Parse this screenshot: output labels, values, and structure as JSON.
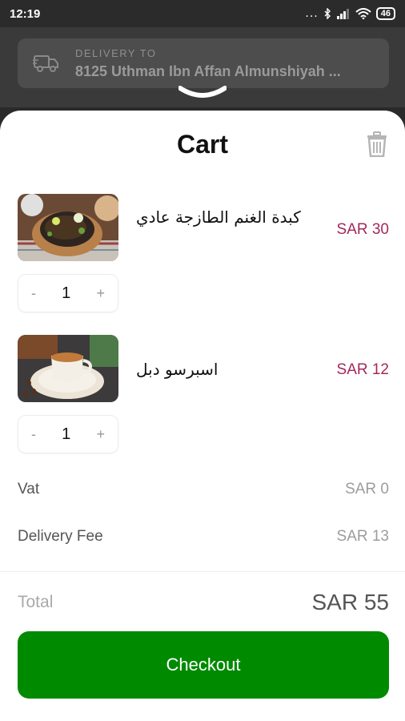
{
  "status_bar": {
    "time": "12:19",
    "dots": "...",
    "battery": "46"
  },
  "header": {
    "delivery_label": "DELIVERY TO",
    "delivery_address": "8125 Uthman Ibn Affan Almunshiyah ..."
  },
  "cart": {
    "title": "Cart",
    "items": [
      {
        "name": "كبدة الغنم الطازجة عادي",
        "price": "SAR 30",
        "quantity": "1",
        "minus": "-",
        "plus": "+"
      },
      {
        "name": "اسبرسو دبل",
        "price": "SAR 12",
        "quantity": "1",
        "minus": "-",
        "plus": "+"
      }
    ],
    "fees": [
      {
        "label": "Vat",
        "value": "SAR 0"
      },
      {
        "label": "Delivery Fee",
        "value": "SAR 13"
      }
    ],
    "total_label": "Total",
    "total_value": "SAR 55",
    "checkout_label": "Checkout"
  },
  "colors": {
    "accent_price": "#a3295a",
    "checkout_green": "#008a00"
  }
}
